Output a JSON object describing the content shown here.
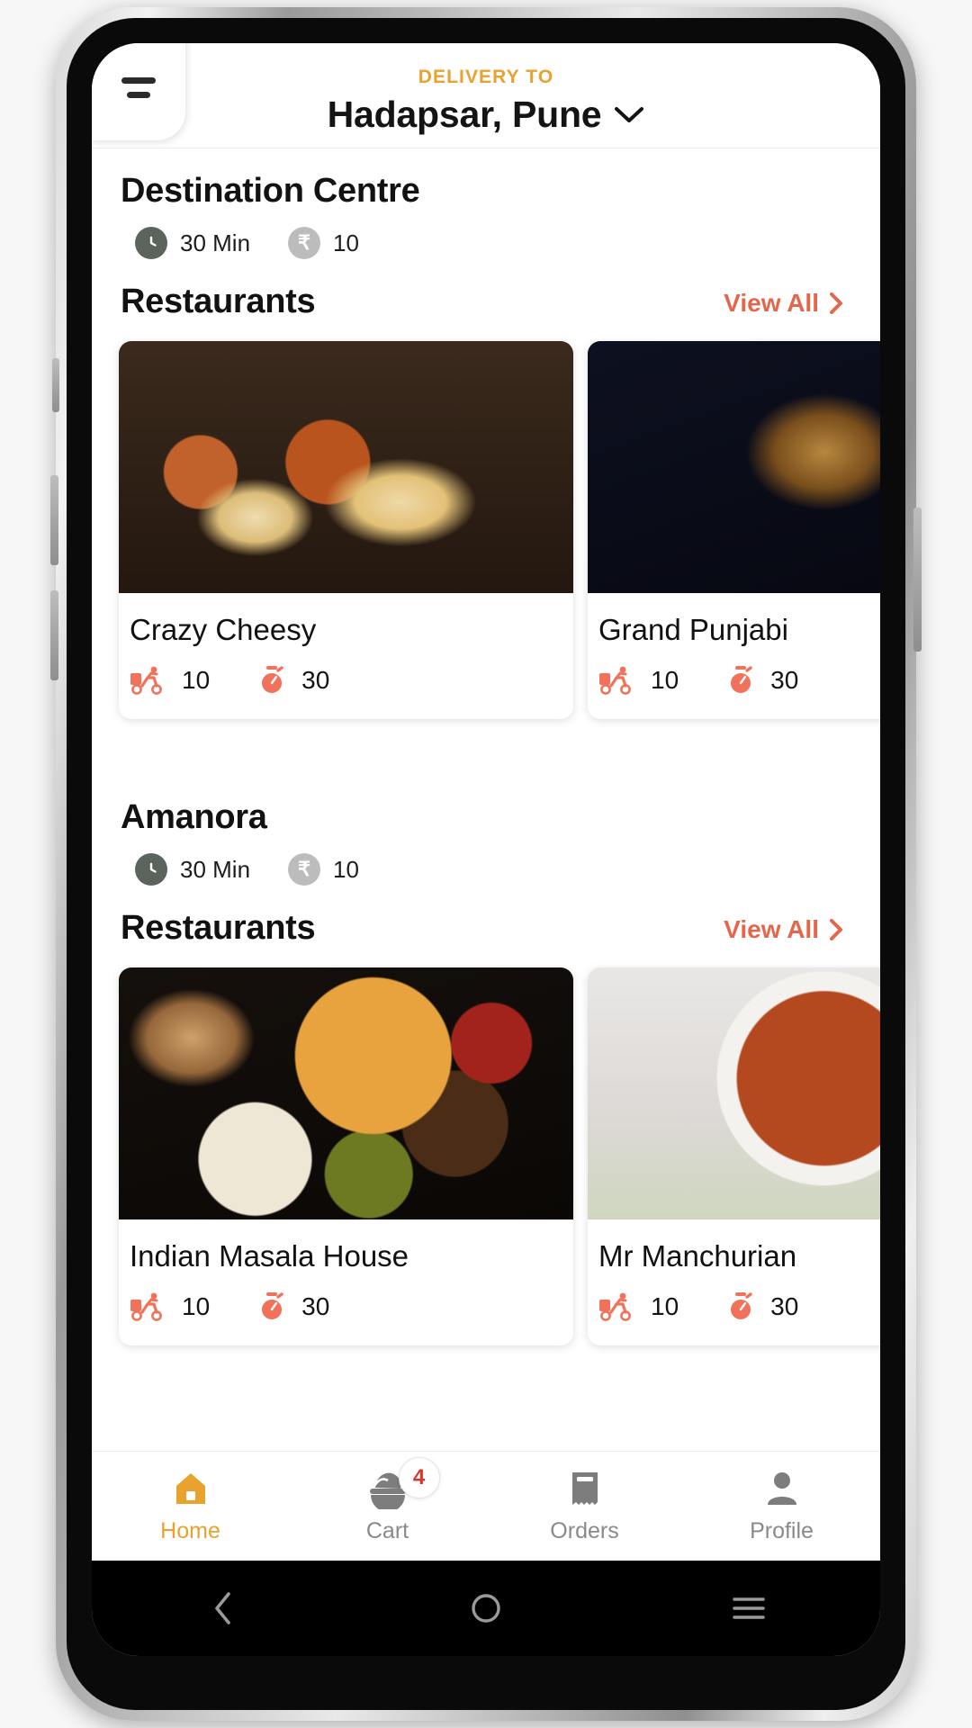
{
  "header": {
    "delivery_to_label": "DELIVERY TO",
    "address": "Hadapsar, Pune",
    "menu_icon": "hamburger-menu-icon",
    "chevron_icon": "chevron-down-icon",
    "accent_color": "#E8A22E"
  },
  "sections": [
    {
      "title": "Destination Centre",
      "time_value": "30 Min",
      "price_value": "10",
      "restaurants_label": "Restaurants",
      "view_all_label": "View All",
      "cards": [
        {
          "name": "Crazy Cheesy",
          "delivery_fee": "10",
          "time": "30",
          "image": "burgers-and-fries-photo"
        },
        {
          "name": "Grand Punjabi",
          "delivery_fee": "10",
          "time": "30",
          "image": "dark-spices-photo"
        }
      ]
    },
    {
      "title": "Amanora",
      "time_value": "30 Min",
      "price_value": "10",
      "restaurants_label": "Restaurants",
      "view_all_label": "View All",
      "cards": [
        {
          "name": "Indian Masala House",
          "delivery_fee": "10",
          "time": "30",
          "image": "indian-thali-photo"
        },
        {
          "name": "Mr Manchurian",
          "delivery_fee": "10",
          "time": "30",
          "image": "curry-bowl-photo"
        }
      ]
    }
  ],
  "bottom_nav": {
    "items": [
      {
        "label": "Home",
        "icon": "home-icon",
        "active": true
      },
      {
        "label": "Cart",
        "icon": "food-basket-icon",
        "badge": "4",
        "active": false
      },
      {
        "label": "Orders",
        "icon": "receipt-icon",
        "active": false
      },
      {
        "label": "Profile",
        "icon": "person-icon",
        "active": false
      }
    ]
  },
  "system_nav": {
    "back": "back-triangle-icon",
    "home": "home-circle-icon",
    "recents": "recents-lines-icon"
  },
  "colors": {
    "brand_amber": "#E8A22E",
    "accent_salmon": "#E4674B",
    "badge_red": "#d6392b"
  }
}
